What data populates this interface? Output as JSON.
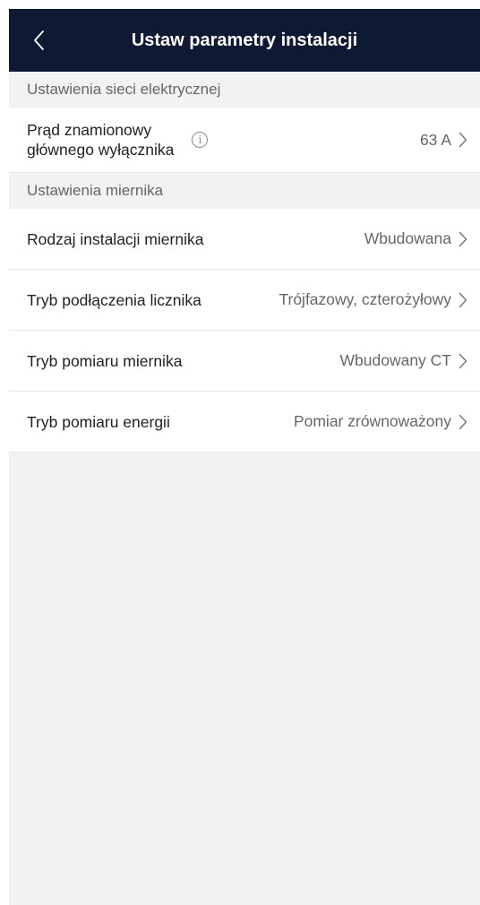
{
  "header": {
    "title": "Ustaw parametry instalacji"
  },
  "sections": [
    {
      "title": "Ustawienia sieci elektrycznej",
      "rows": [
        {
          "label_line1": "Prąd znamionowy",
          "label_line2": "głównego wyłącznika",
          "value": "63 A",
          "icon": "info-icon"
        }
      ]
    },
    {
      "title": "Ustawienia miernika",
      "rows": [
        {
          "label": "Rodzaj instalacji miernika",
          "value": "Wbudowana"
        },
        {
          "label": "Tryb podłączenia licznika",
          "value": "Trójfazowy, czterożyłowy"
        },
        {
          "label": "Tryb pomiaru miernika",
          "value": "Wbudowany CT"
        },
        {
          "label": "Tryb pomiaru energii",
          "value": "Pomiar zrównoważony"
        }
      ]
    }
  ],
  "info_glyph": "i",
  "colors": {
    "header_bg": "#0e1a33",
    "background": "#f2f2f2",
    "row_bg": "#ffffff"
  }
}
